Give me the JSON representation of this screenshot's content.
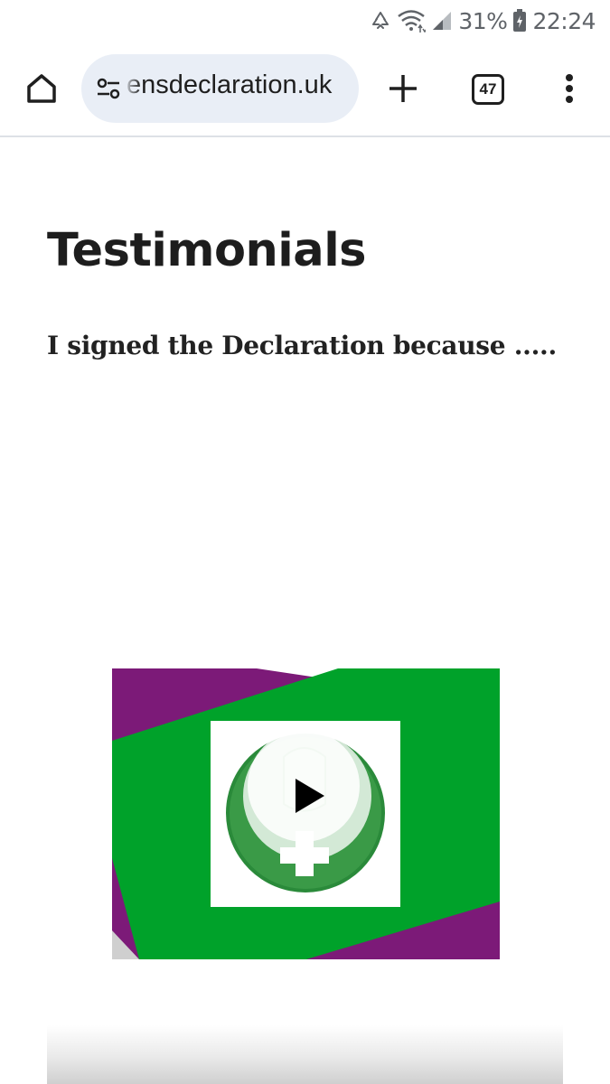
{
  "status_bar": {
    "battery_percent": "31%",
    "time": "22:24",
    "icons": [
      "recycle-icon",
      "wifi-icon",
      "signal-icon",
      "battery-charging-icon"
    ]
  },
  "toolbar": {
    "url": "ensdeclaration.uk",
    "tab_count": "47",
    "icons": [
      "home-icon",
      "site-info-icon",
      "plus-icon",
      "tabs-icon",
      "more-vert-icon"
    ]
  },
  "page": {
    "title": "Testimonials",
    "subtitle": "I signed the Declaration because ....."
  },
  "video": {
    "icons": [
      "play-icon",
      "women-symbol-fist-icon"
    ],
    "colors": {
      "green": "#00a22a",
      "purple": "#7c1a78",
      "dark_green": "#2a8a3a"
    }
  }
}
